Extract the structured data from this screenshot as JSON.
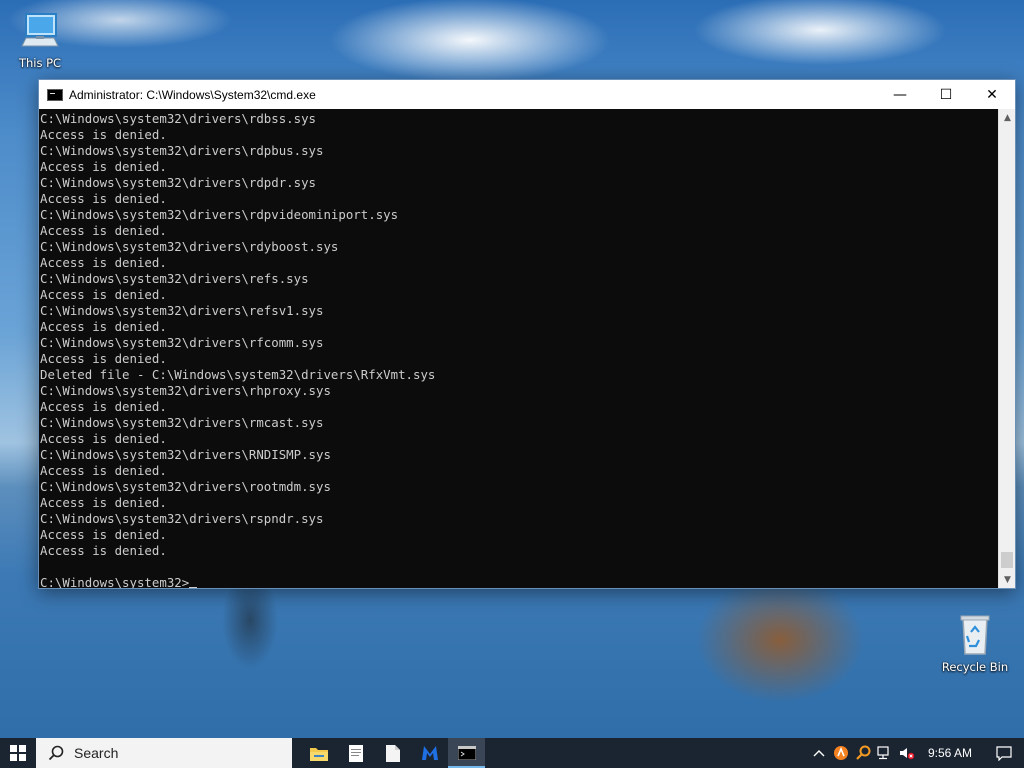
{
  "desktop": {
    "icons": [
      {
        "label": "This PC"
      },
      {
        "label": "Recycle Bin"
      }
    ]
  },
  "window": {
    "title": "Administrator: C:\\Windows\\System32\\cmd.exe",
    "controls": {
      "minimize": "—",
      "maximize": "☐",
      "close": "✕"
    }
  },
  "console": {
    "lines": [
      "C:\\Windows\\system32\\drivers\\rdbss.sys",
      "Access is denied.",
      "C:\\Windows\\system32\\drivers\\rdpbus.sys",
      "Access is denied.",
      "C:\\Windows\\system32\\drivers\\rdpdr.sys",
      "Access is denied.",
      "C:\\Windows\\system32\\drivers\\rdpvideominiport.sys",
      "Access is denied.",
      "C:\\Windows\\system32\\drivers\\rdyboost.sys",
      "Access is denied.",
      "C:\\Windows\\system32\\drivers\\refs.sys",
      "Access is denied.",
      "C:\\Windows\\system32\\drivers\\refsv1.sys",
      "Access is denied.",
      "C:\\Windows\\system32\\drivers\\rfcomm.sys",
      "Access is denied.",
      "Deleted file - C:\\Windows\\system32\\drivers\\RfxVmt.sys",
      "C:\\Windows\\system32\\drivers\\rhproxy.sys",
      "Access is denied.",
      "C:\\Windows\\system32\\drivers\\rmcast.sys",
      "Access is denied.",
      "C:\\Windows\\system32\\drivers\\RNDISMP.sys",
      "Access is denied.",
      "C:\\Windows\\system32\\drivers\\rootmdm.sys",
      "Access is denied.",
      "C:\\Windows\\system32\\drivers\\rspndr.sys",
      "Access is denied.",
      "Access is denied.",
      ""
    ],
    "prompt": "C:\\Windows\\system32>"
  },
  "taskbar": {
    "search_placeholder": "Search",
    "apps": [
      {
        "name": "file-explorer",
        "active": false
      },
      {
        "name": "notepad",
        "active": false
      },
      {
        "name": "document",
        "active": false
      },
      {
        "name": "malwarebytes",
        "active": false
      },
      {
        "name": "command-prompt",
        "active": true
      }
    ],
    "clock": "9:56 AM"
  },
  "colors": {
    "console_bg": "#0c0c0c",
    "console_text": "#cccccc",
    "taskbar_bg": "#1b2532",
    "accent": "#76b9ed"
  }
}
